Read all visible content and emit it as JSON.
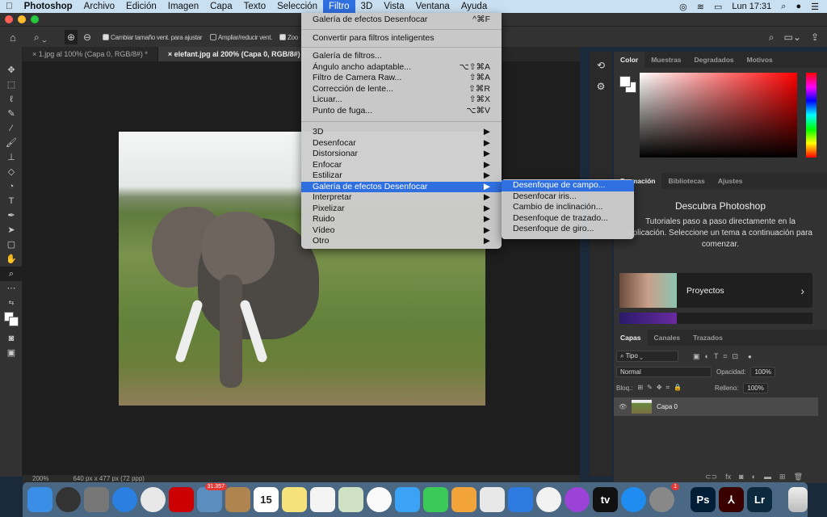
{
  "menubar": {
    "app": "Photoshop",
    "items": [
      "Archivo",
      "Edición",
      "Imagen",
      "Capa",
      "Texto",
      "Selección",
      "Filtro",
      "3D",
      "Vista",
      "Ventana",
      "Ayuda"
    ],
    "clock": "Lun 17:31"
  },
  "options": {
    "resize_windows": "Cambiar tamaño vent. para ajustar",
    "resize_checked": true,
    "zoom_all": "Ampliar/reducir vent.",
    "zoom_all_checked": false,
    "scrubby": "Zoo"
  },
  "tabs": [
    {
      "label": "1.jpg al 100% (Capa 0, RGB/8#) *",
      "active": false
    },
    {
      "label": "elefant.jpg al 200% (Capa 0, RGB/8#) *",
      "active": true
    }
  ],
  "statusbar": {
    "zoom": "200%",
    "doc_info": "640 px x 477 px (72 ppp)"
  },
  "filter_menu": {
    "top": [
      {
        "label": "Galería de efectos Desenfocar",
        "shortcut": "^⌘F"
      }
    ],
    "smart": [
      {
        "label": "Convertir para filtros inteligentes",
        "shortcut": ""
      }
    ],
    "filters": [
      {
        "label": "Galería de filtros...",
        "shortcut": ""
      },
      {
        "label": "Ángulo ancho adaptable...",
        "shortcut": "⌥⇧⌘A"
      },
      {
        "label": "Filtro de Camera Raw...",
        "shortcut": "⇧⌘A"
      },
      {
        "label": "Corrección de lente...",
        "shortcut": "⇧⌘R"
      },
      {
        "label": "Licuar...",
        "shortcut": "⇧⌘X"
      },
      {
        "label": "Punto de fuga...",
        "shortcut": "⌥⌘V"
      }
    ],
    "submenus": [
      "3D",
      "Desenfocar",
      "Distorsionar",
      "Enfocar",
      "Estilizar",
      "Galería de efectos Desenfocar",
      "Interpretar",
      "Pixelizar",
      "Ruido",
      "Vídeo",
      "Otro"
    ],
    "highlighted": "Galería de efectos Desenfocar"
  },
  "blur_gallery_submenu": [
    "Desenfoque de campo...",
    "Desenfocar iris...",
    "Cambio de inclinación...",
    "Desenfoque de trazado...",
    "Desenfoque de giro..."
  ],
  "color_panel": {
    "tabs": [
      "Color",
      "Muestras",
      "Degradados",
      "Motivos"
    ],
    "hue_color": "#ff0000"
  },
  "learn_panel": {
    "tabs": [
      "Formación",
      "Bibliotecas",
      "Ajustes"
    ],
    "title": "Descubra Photoshop",
    "description": "Tutoriales paso a paso directamente en la aplicación. Seleccione un tema a continuación para comenzar.",
    "card": "Proyectos"
  },
  "layers_panel": {
    "tabs": [
      "Capas",
      "Canales",
      "Trazados"
    ],
    "filter": "Tipo",
    "blend_mode": "Normal",
    "opacity_label": "Opacidad:",
    "opacity": "100%",
    "lock_label": "Bloq.:",
    "fill_label": "Relleno:",
    "fill": "100%",
    "layers": [
      {
        "name": "Capa 0",
        "visible": true
      }
    ]
  },
  "dock": {
    "apps": [
      {
        "name": "finder",
        "color": "#3a8ee6"
      },
      {
        "name": "siri",
        "color": "#333"
      },
      {
        "name": "launchpad",
        "color": "#777"
      },
      {
        "name": "safari",
        "color": "#2a7fe0"
      },
      {
        "name": "chrome",
        "color": "#e8e8e8"
      },
      {
        "name": "acrobat",
        "color": "#c00"
      },
      {
        "name": "mail",
        "color": "#5b8dbf",
        "badge": "31.357"
      },
      {
        "name": "contacts",
        "color": "#b0844e"
      },
      {
        "name": "calendar",
        "color": "#fff",
        "text": "15"
      },
      {
        "name": "notes",
        "color": "#f5e27a"
      },
      {
        "name": "reminders",
        "color": "#f4f4f4"
      },
      {
        "name": "maps",
        "color": "#cfe3c4"
      },
      {
        "name": "photos",
        "color": "#fafafa"
      },
      {
        "name": "messages",
        "color": "#3aa3f5"
      },
      {
        "name": "facetime",
        "color": "#3bc957"
      },
      {
        "name": "pages",
        "color": "#f2a33a"
      },
      {
        "name": "numbers",
        "color": "#e8e8e8"
      },
      {
        "name": "keynote",
        "color": "#2d7be0"
      },
      {
        "name": "music",
        "color": "#f2f2f2"
      },
      {
        "name": "podcasts",
        "color": "#9b43d6"
      },
      {
        "name": "apple-tv",
        "color": "#111",
        "text": "tv"
      },
      {
        "name": "app-store",
        "color": "#1e8cf0"
      },
      {
        "name": "system-preferences",
        "color": "#888",
        "badge": "1"
      }
    ],
    "pinned": [
      {
        "name": "photoshop",
        "color": "#001e36",
        "text": "Ps"
      },
      {
        "name": "acrobat-dc",
        "color": "#3a0000",
        "text": "⅄"
      },
      {
        "name": "lightroom",
        "color": "#0b2a3d",
        "text": "Lr"
      }
    ],
    "trash": "trash"
  }
}
